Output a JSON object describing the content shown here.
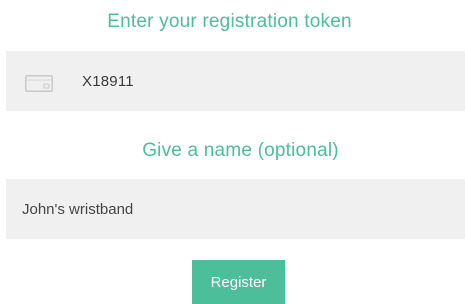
{
  "token_section": {
    "heading": "Enter your registration token",
    "input_value": "X18911",
    "icon": "card-icon"
  },
  "name_section": {
    "heading": "Give a name (optional)",
    "input_value": "John's wristband"
  },
  "register_button": {
    "label": "Register"
  },
  "colors": {
    "accent": "#4cbf9a",
    "field_background": "#f0f0f0",
    "text": "#3a3a3a"
  }
}
